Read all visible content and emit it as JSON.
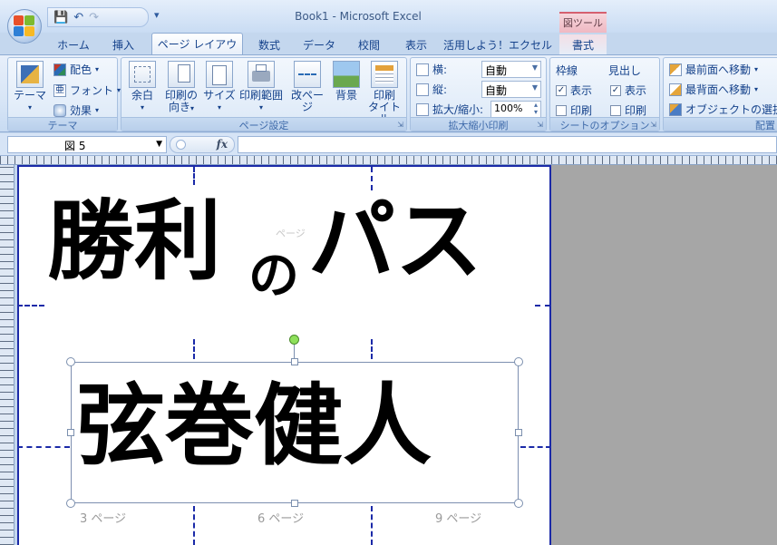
{
  "window": {
    "title": "Book1 - Microsoft Excel"
  },
  "contextual_tab": {
    "label": "図ツール"
  },
  "qat": {
    "more": "▾"
  },
  "tabs": [
    {
      "label": "ホーム"
    },
    {
      "label": "挿入"
    },
    {
      "label": "ページ レイアウト"
    },
    {
      "label": "数式"
    },
    {
      "label": "データ"
    },
    {
      "label": "校閲"
    },
    {
      "label": "表示"
    },
    {
      "label": "活用しよう！エクセル"
    },
    {
      "label": "書式"
    }
  ],
  "ribbon": {
    "theme": {
      "group_label": "テーマ",
      "theme_button": "テーマ",
      "colors": "配色",
      "fonts": "フォント",
      "effects": "効果"
    },
    "page_setup": {
      "group_label": "ページ設定",
      "margins": "余白",
      "orientation_1": "印刷の",
      "orientation_2": "向き",
      "size": "サイズ",
      "print_area": "印刷範囲",
      "breaks": "改ページ",
      "background": "背景",
      "titles_1": "印刷",
      "titles_2": "タイトル"
    },
    "scale": {
      "group_label": "拡大縮小印刷",
      "width_label": "横:",
      "width_value": "自動",
      "height_label": "縦:",
      "height_value": "自動",
      "scale_label": "拡大/縮小:",
      "scale_value": "100%"
    },
    "sheet_options": {
      "group_label": "シートのオプション",
      "gridlines": "枠線",
      "headings": "見出し",
      "view": "表示",
      "print": "印刷",
      "gridlines_view_checked": true,
      "gridlines_print_checked": false,
      "headings_view_checked": true,
      "headings_print_checked": false
    },
    "arrange": {
      "group_label": "配置",
      "bring_front": "最前面へ移動",
      "send_back": "最背面へ移動",
      "selection": "オブジェクトの選択と表"
    }
  },
  "formula_bar": {
    "name_box": "図 5",
    "fx": "fx",
    "formula": ""
  },
  "sheet": {
    "title_text_1": "勝利",
    "title_text_2": "の",
    "title_text_3": "パス",
    "faint_label": "ページ",
    "name_text": "弦巻健人",
    "page_labels": [
      "3 ページ",
      "6 ページ",
      "9 ページ"
    ]
  }
}
